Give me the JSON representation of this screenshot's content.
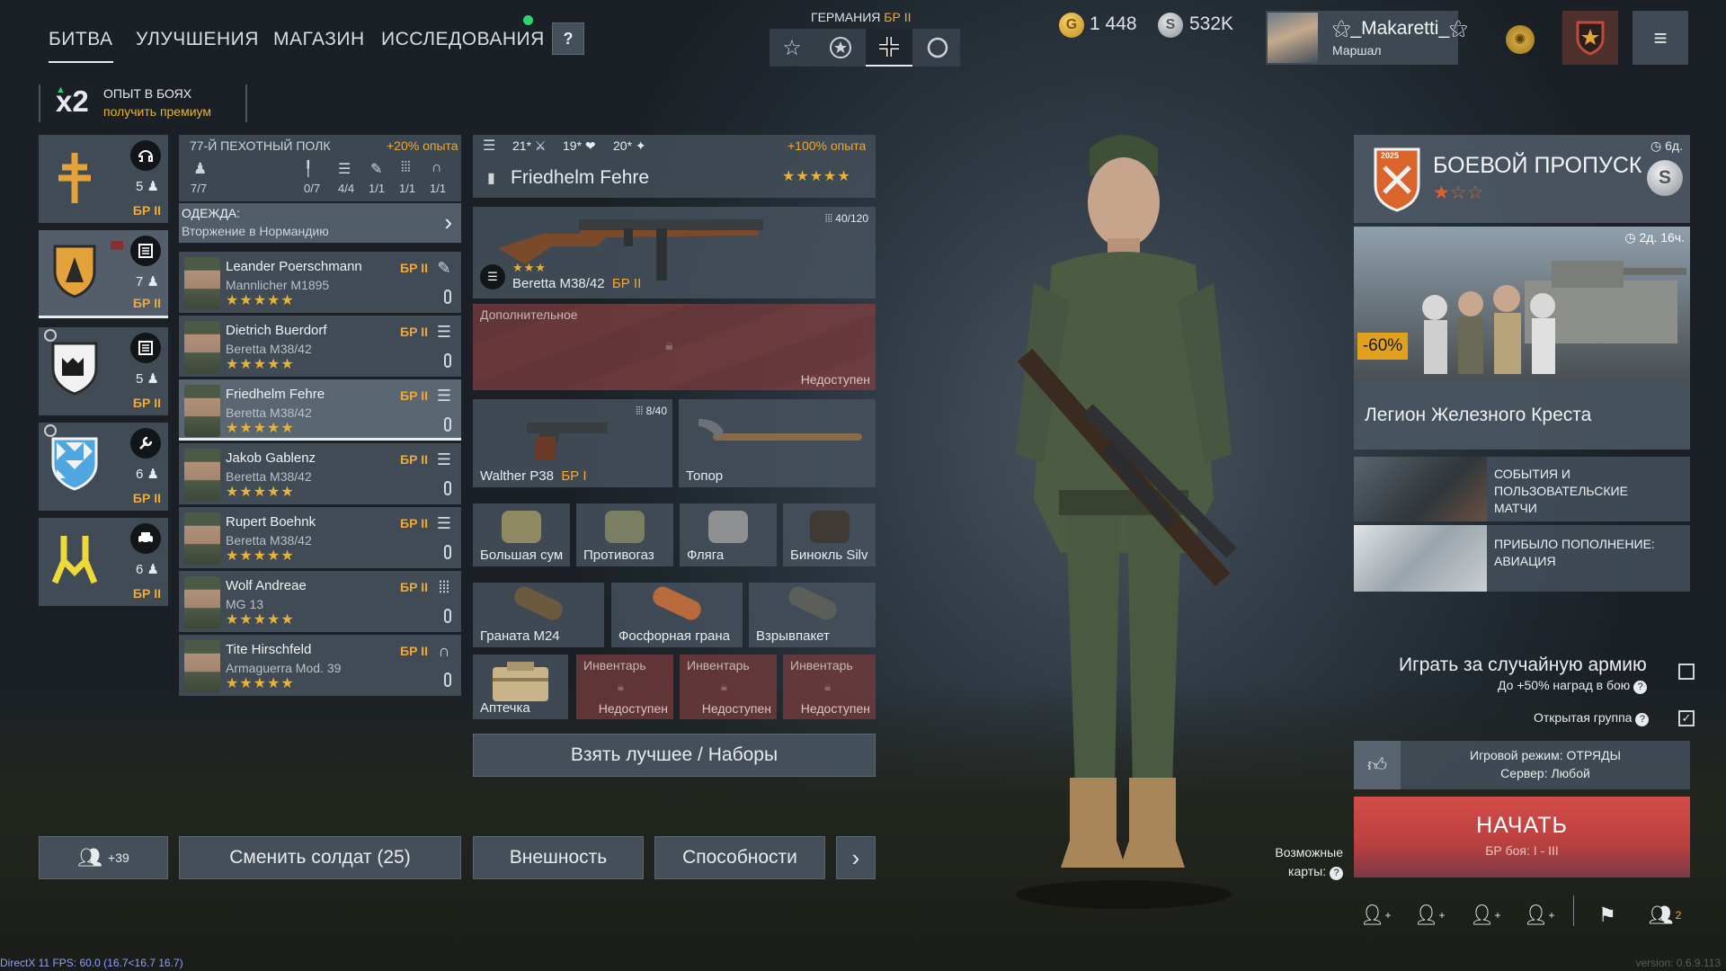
{
  "nav": {
    "tabs": [
      "БИТВА",
      "УЛУЧШЕНИЯ",
      "МАГАЗИН",
      "ИССЛЕДОВАНИЯ"
    ],
    "help": "?"
  },
  "nation": {
    "label": "ГЕРМАНИЯ",
    "br": "БР II"
  },
  "currency": {
    "gold": "1 448",
    "silver": "532K"
  },
  "player": {
    "name": "Makaretti_",
    "rank": "Маршал"
  },
  "xp": {
    "multiplier": "x2",
    "title": "ОПЫТ В БОЯХ",
    "cta": "получить премиум"
  },
  "squad": {
    "regiment": "77-Й ПЕХОТНЫЙ ПОЛК",
    "bonus": "+20% опыта",
    "count": "7/7",
    "slots": [
      "0/7",
      "4/4",
      "1/1",
      "1/1",
      "1/1"
    ],
    "outfit_title": "ОДЕЖДА:",
    "outfit_value": "Вторжение в Нормандию"
  },
  "squads": [
    {
      "count": "5",
      "br": "БР II",
      "icon": "headset-icon"
    },
    {
      "count": "7",
      "br": "БР II",
      "icon": "list-icon"
    },
    {
      "count": "5",
      "br": "БР II",
      "icon": "list-icon"
    },
    {
      "count": "6",
      "br": "БР II",
      "icon": "wrench-icon"
    },
    {
      "count": "6",
      "br": "БР II",
      "icon": "vehicle-icon"
    }
  ],
  "soldiers": [
    {
      "name": "Leander Poerschmann",
      "weapon": "Mannlicher M1895",
      "br": "БР II",
      "stars": "★★★★★",
      "role": "engineer"
    },
    {
      "name": "Dietrich Buerdorf",
      "weapon": "Beretta M38/42",
      "br": "БР II",
      "stars": "★★★★★",
      "role": "assault"
    },
    {
      "name": "Friedhelm Fehre",
      "weapon": "Beretta M38/42",
      "br": "БР II",
      "stars": "★★★★★",
      "role": "assault"
    },
    {
      "name": "Jakob Gablenz",
      "weapon": "Beretta M38/42",
      "br": "БР II",
      "stars": "★★★★★",
      "role": "assault"
    },
    {
      "name": "Rupert Boehnk",
      "weapon": "Beretta M38/42",
      "br": "БР II",
      "stars": "★★★★★",
      "role": "assault"
    },
    {
      "name": "Wolf Andreae",
      "weapon": "MG 13",
      "br": "БР II",
      "stars": "★★★★★",
      "role": "machinegunner"
    },
    {
      "name": "Tite Hirschfeld",
      "weapon": "Armaguerra Mod. 39",
      "br": "БР II",
      "stars": "★★★★★",
      "role": "radio"
    }
  ],
  "selected": {
    "name": "Friedhelm Fehre",
    "stats": [
      "21*",
      "19*",
      "20*"
    ],
    "bonus": "+100% опыта",
    "stars": "★★★★★"
  },
  "primary": {
    "name": "Beretta M38/42",
    "br": "БР II",
    "ammo": "40/120",
    "stars": "★★★"
  },
  "secondary": {
    "label": "Дополнительное",
    "status": "Недоступен"
  },
  "sidearm": {
    "name": "Walther P38",
    "br": "БР I",
    "ammo": "8/40"
  },
  "melee": {
    "name": "Топор"
  },
  "items1": [
    "Большая сум",
    "Противогаз",
    "Фляга",
    "Бинокль Silv"
  ],
  "items2": [
    "Граната M24",
    "Фосфорная грана",
    "Взрывпакет"
  ],
  "inv": {
    "first": "Аптечка",
    "locked_label": "Инвентарь",
    "locked_status": "Недоступен"
  },
  "take_best": "Взять лучшее / Наборы",
  "bottom": {
    "squad_count": "+39",
    "change": "Сменить солдат (25)",
    "appearance": "Внешность",
    "abilities": "Способности",
    "more": "›"
  },
  "battlepass": {
    "title": "БОЕВОЙ ПРОПУСК",
    "timer": "6д.",
    "stars": "★☆☆",
    "year": "2025"
  },
  "promo": {
    "discount": "-60%",
    "timer": "2д. 16ч.",
    "title": "Легион Железного Креста"
  },
  "events": [
    {
      "label": "СОБЫТИЯ И ПОЛЬЗОВАТЕЛЬСКИЕ МАТЧИ"
    },
    {
      "label": "ПРИБЫЛО ПОПОЛНЕНИЕ: АВИАЦИЯ"
    }
  ],
  "random_army": {
    "label": "Играть за случайную армию",
    "sub": "До +50% наград в бою"
  },
  "open_group": "Открытая группа",
  "mode": {
    "line1": "Игровой режим: ОТРЯДЫ",
    "line2": "Сервер: Любой"
  },
  "start": {
    "label": "НАЧАТЬ",
    "sub": "БР боя: I - III"
  },
  "maps": {
    "label1": "Возможные",
    "label2": "карты:"
  },
  "party_count": "2",
  "fps": "DirectX 11 FPS: 60.0 (16.7<16.7 16.7)",
  "version": "version: 0.6.9.113",
  "colors": {
    "accent": "#f0a838",
    "start": "#c94a47",
    "locked": "#7a3c3e"
  }
}
